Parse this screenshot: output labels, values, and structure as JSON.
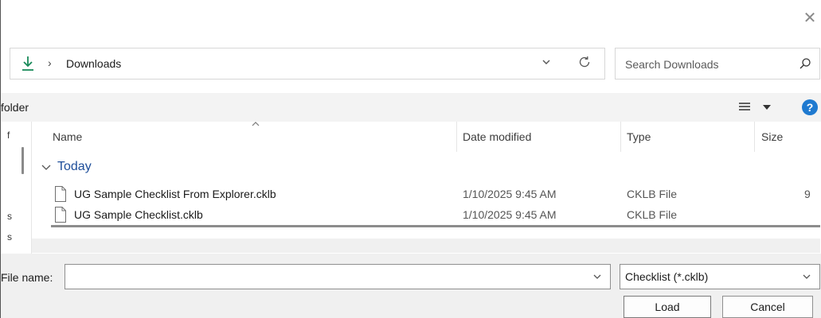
{
  "address": {
    "crumb": "Downloads"
  },
  "search": {
    "placeholder": "Search Downloads"
  },
  "toolbar": {
    "new_folder": "folder"
  },
  "nav": {
    "item1": "f",
    "item2": "s",
    "item3": "s"
  },
  "columns": {
    "name": "Name",
    "date": "Date modified",
    "type": "Type",
    "size": "Size"
  },
  "group": {
    "label": "Today"
  },
  "files": [
    {
      "name": "UG Sample Checklist From Explorer.cklb",
      "date": "1/10/2025 9:45 AM",
      "type": "CKLB File",
      "size": "9"
    },
    {
      "name": "UG Sample Checklist.cklb",
      "date": "1/10/2025 9:45 AM",
      "type": "CKLB File",
      "size": ""
    }
  ],
  "footer": {
    "file_name_label": "File name:",
    "file_name_value": "",
    "filter_selected": "Checklist (*.cklb)",
    "load_label": "Load",
    "cancel_label": "Cancel"
  },
  "icons": {
    "close": "close-icon",
    "download": "download-arrow-icon",
    "refresh": "refresh-icon",
    "search": "search-icon",
    "view": "view-options-icon",
    "help": "help-icon",
    "file": "file-icon"
  },
  "colors": {
    "accent": "#1f7ad0",
    "group_text": "#1e4e9a",
    "download_icon": "#1a8a5a"
  }
}
